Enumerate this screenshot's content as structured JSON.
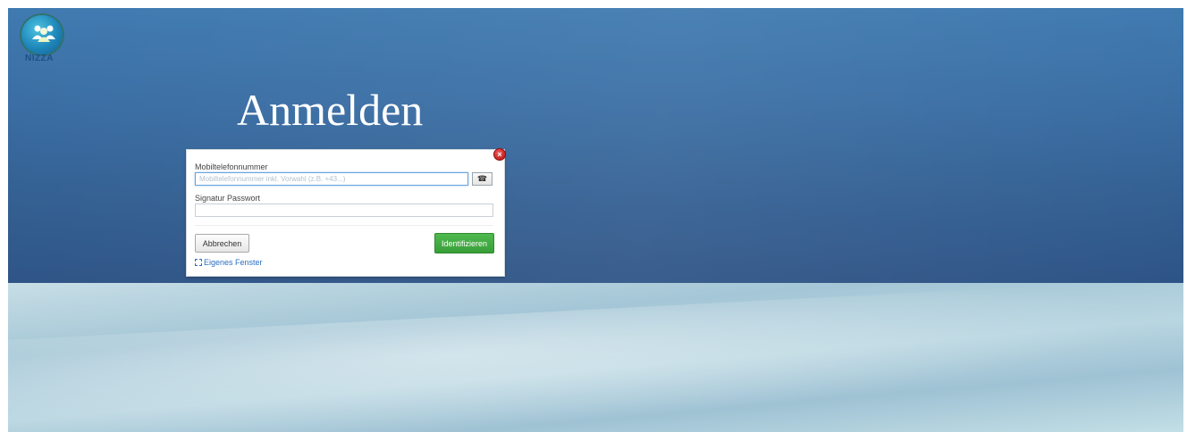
{
  "logo": {
    "text": "NIZZA",
    "icon": "people-group-icon"
  },
  "page": {
    "title": "Anmelden"
  },
  "dialog": {
    "close_icon": "close-icon",
    "close_glyph": "×",
    "mobile_label": "Mobiltelefonnummer",
    "mobile_placeholder": "Mobiltelefonnummer inkl. Vorwahl (z.B. +43...)",
    "mobile_value": "",
    "phone_book_icon": "phone-book-icon",
    "phone_book_glyph": "☎",
    "password_label": "Signatur Passwort",
    "password_value": "",
    "cancel_label": "Abbrechen",
    "identify_label": "Identifizieren",
    "own_window_label": "Eigenes Fenster"
  },
  "colors": {
    "header_blue": "#3a6ea4",
    "lower_light_blue": "#b3d2de",
    "identify_green": "#43a943",
    "link_blue": "#2a6fc0",
    "close_red": "#c91f1f"
  }
}
